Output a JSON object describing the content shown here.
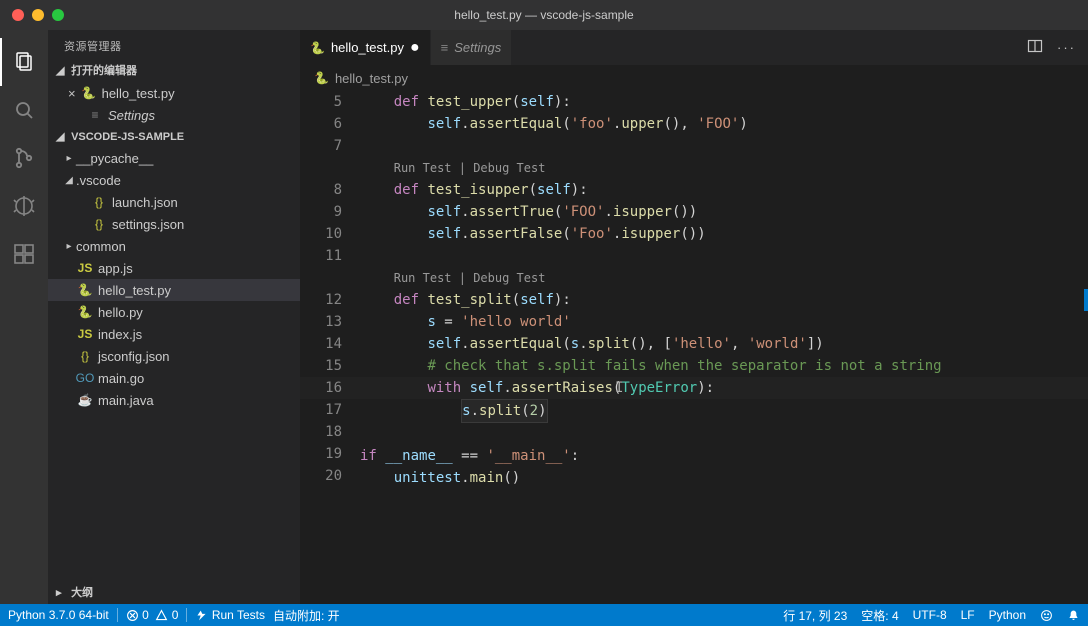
{
  "window": {
    "title": "hello_test.py — vscode-js-sample"
  },
  "sidebar": {
    "title": "资源管理器",
    "open_editors_label": "打开的编辑器",
    "workspace_label": "VSCODE-JS-SAMPLE",
    "outline_label": "大纲",
    "open_editors": [
      {
        "label": "hello_test.py",
        "dirty": true
      },
      {
        "label": "Settings"
      }
    ],
    "tree": {
      "pycache": "__pycache__",
      "vscode": ".vscode",
      "launch": "launch.json",
      "settingsjson": "settings.json",
      "common": "common",
      "appjs": "app.js",
      "hellotest": "hello_test.py",
      "hellopy": "hello.py",
      "indexjs": "index.js",
      "jsconfig": "jsconfig.json",
      "maingo": "main.go",
      "mainjava": "main.java"
    }
  },
  "tabs": [
    {
      "label": "hello_test.py",
      "dirty": true
    },
    {
      "label": "Settings"
    }
  ],
  "breadcrumb": "hello_test.py",
  "codelens": {
    "run": "Run Test",
    "debug": "Debug Test"
  },
  "ln": {
    "5": "5",
    "6": "6",
    "7": "7",
    "8": "8",
    "9": "9",
    "10": "10",
    "11": "11",
    "12": "12",
    "13": "13",
    "14": "14",
    "15": "15",
    "16": "16",
    "17": "17",
    "18": "18",
    "19": "19",
    "20": "20"
  },
  "code": {
    "def": "def",
    "if": "if",
    "with": "with",
    "selfp": "self",
    "test_upper": "test_upper",
    "test_isupper": "test_isupper",
    "test_split": "test_split",
    "assertEqual": "assertEqual",
    "assertTrue": "assertTrue",
    "assertFalse": "assertFalse",
    "assertRaises": "assertRaises",
    "upper": "upper",
    "isupper": "isupper",
    "split": "split",
    "main": "main",
    "foo": "'foo'",
    "FOO": "'FOO'",
    "Foo": "'Foo'",
    "hello_world": "'hello world'",
    "hello": "'hello'",
    "world": "'world'",
    "mainstr": "'__main__'",
    "name": "__name__",
    "unittest": "unittest",
    "TypeError": "TypeError",
    "s": "s",
    "two": "2",
    "comment": "# check that s.split fails when the separator is not a string"
  },
  "status": {
    "python": "Python 3.7.0 64-bit",
    "errors": "0",
    "warnings": "0",
    "runtests": "Run Tests",
    "autoattach": "自动附加: 开",
    "lncol": "行 17, 列 23",
    "spaces": "空格: 4",
    "encoding": "UTF-8",
    "eol": "LF",
    "lang": "Python"
  }
}
